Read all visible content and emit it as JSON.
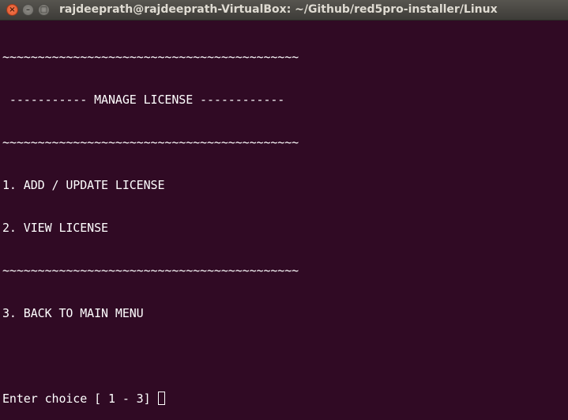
{
  "window": {
    "title": "rajdeeprath@rajdeeprath-VirtualBox: ~/Github/red5pro-installer/Linux"
  },
  "terminal": {
    "lines": [
      "~~~~~~~~~~~~~~~~~~~~~~~~~~~~~~~~~~~~~~~~~~",
      " ----------- MANAGE LICENSE ------------",
      "~~~~~~~~~~~~~~~~~~~~~~~~~~~~~~~~~~~~~~~~~~",
      "1. ADD / UPDATE LICENSE",
      "2. VIEW LICENSE",
      "~~~~~~~~~~~~~~~~~~~~~~~~~~~~~~~~~~~~~~~~~~",
      "3. BACK TO MAIN MENU",
      ""
    ],
    "prompt": "Enter choice [ 1 - 3]"
  }
}
